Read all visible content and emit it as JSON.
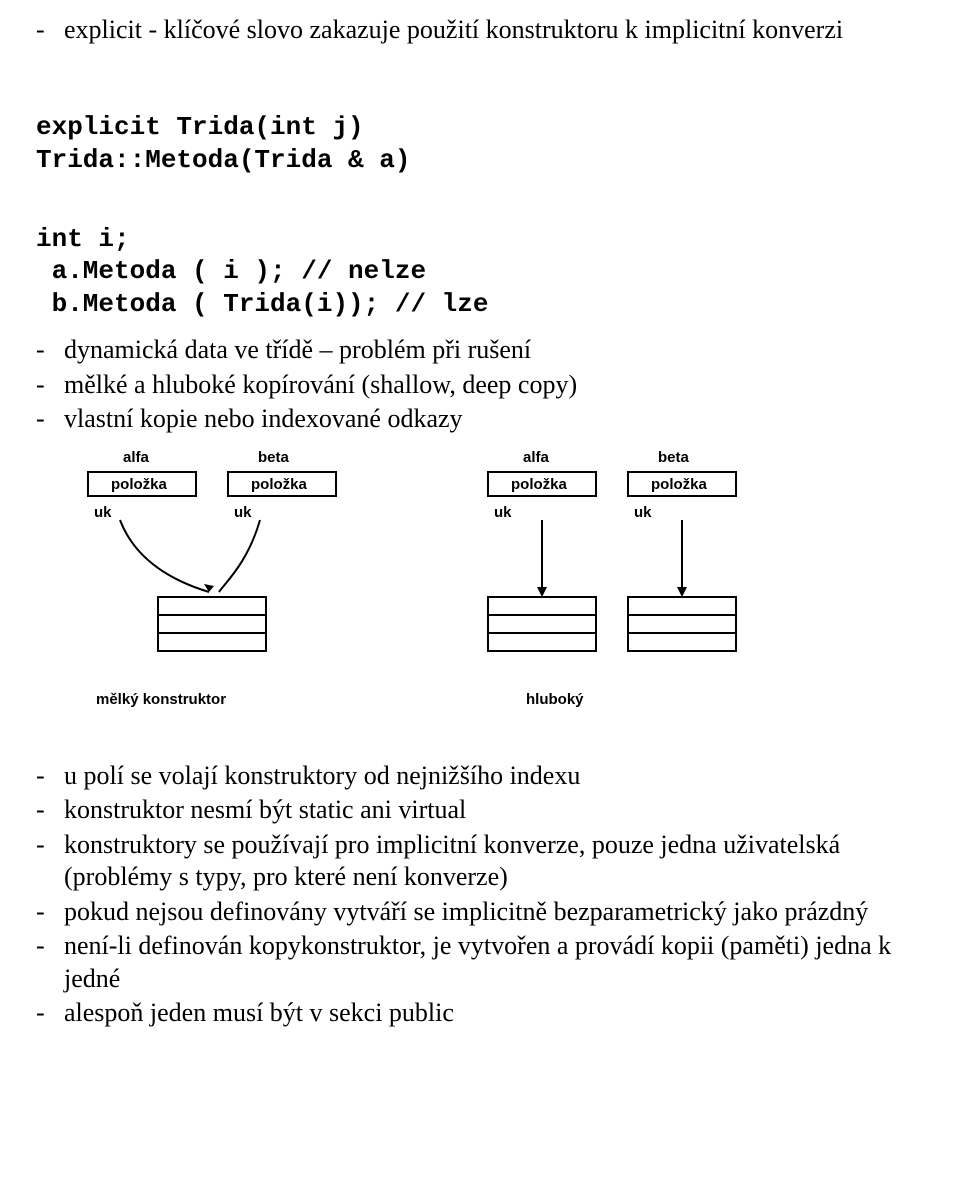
{
  "bullets_top": {
    "b0": "explicit - klíčové slovo zakazuje použití konstruktoru k implicitní konverzi"
  },
  "code_block1": {
    "l0": "explicit Trida(int j)",
    "l1": "Trida::Metoda(Trida & a)"
  },
  "code_block2": {
    "l0": "int i;",
    "l1": " a.Metoda ( i ); // nelze",
    "l2": " b.Metoda ( Trida(i)); // lze"
  },
  "bullets_mid": {
    "b0": "dynamická data ve třídě – problém při rušení",
    "b1": "mělké a hluboké kopírování (shallow, deep copy)",
    "b2": "vlastní kopie nebo indexované odkazy"
  },
  "bullets_bottom": {
    "b0": "u polí se volají konstruktory od nejnižšího indexu",
    "b1": "konstruktor nesmí být static ani virtual",
    "b2": "konstruktory se používají pro implicitní konverze, pouze jedna uživatelská (problémy s typy, pro které není konverze)",
    "b3": "pokud nejsou definovány vytváří se implicitně bezparametrický jako prázdný",
    "b4": "není-li definován kopykonstruktor, je vytvořen a provádí kopii (paměti) jedna k jedné",
    "b5": "alespoň jeden musí být v sekci public"
  },
  "diagram": {
    "labels": {
      "alfa": "alfa",
      "beta": "beta",
      "polozka": "položka",
      "uk": "uk",
      "shallow": "mělký konstruktor",
      "deep": "hluboký"
    }
  }
}
